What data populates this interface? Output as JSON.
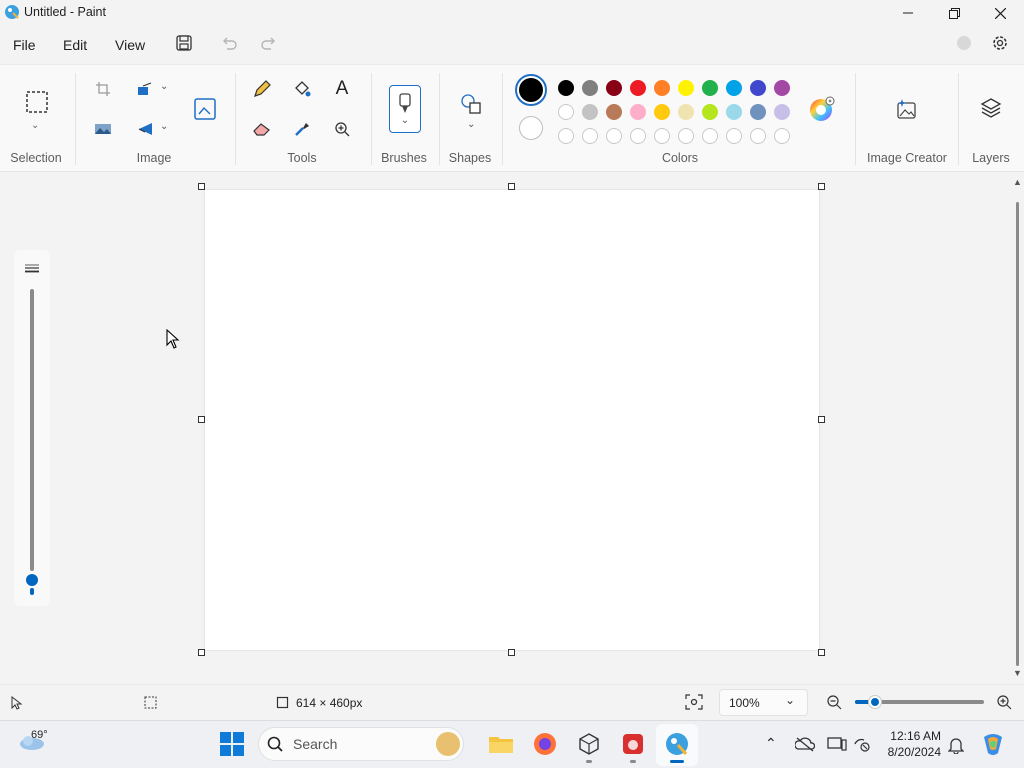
{
  "window": {
    "title": "Untitled - Paint",
    "minimize_icon": "minimize-icon",
    "restore_icon": "restore-icon",
    "close_icon": "close-icon"
  },
  "menu": {
    "items": [
      "File",
      "Edit",
      "View"
    ]
  },
  "ribbon": {
    "groups": {
      "selection": "Selection",
      "image": "Image",
      "tools": "Tools",
      "brushes": "Brushes",
      "shapes": "Shapes",
      "colors": "Colors",
      "image_creator": "Image Creator",
      "layers": "Layers"
    },
    "palette_row1": [
      "#000000",
      "#7f7f7f",
      "#880015",
      "#ed1c24",
      "#ff7f27",
      "#fff200",
      "#22b14c",
      "#00a2e8",
      "#3f48cc",
      "#a349a4"
    ],
    "palette_row2": [
      "#ffffff",
      "#c3c3c3",
      "#b97a57",
      "#ffaec9",
      "#ffc90e",
      "#efe4b0",
      "#b5e61d",
      "#99d9ea",
      "#7092be",
      "#c8bfe7"
    ],
    "primary_color": "#000000",
    "secondary_color": "#ffffff",
    "accent": "#0067c0"
  },
  "status": {
    "canvas_size": "614 × 460px",
    "zoom": "100%",
    "zoom_fraction": 0.5
  },
  "taskbar": {
    "weather_temp": "69°",
    "search_placeholder": "Search",
    "time": "12:16 AM",
    "date": "8/20/2024"
  }
}
